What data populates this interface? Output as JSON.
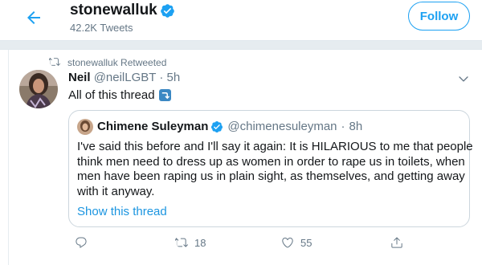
{
  "header": {
    "account_name": "stonewalluk",
    "tweet_count": "42.2K Tweets",
    "follow_label": "Follow"
  },
  "retweet_context": {
    "text": "stonewalluk Retweeted"
  },
  "tweet": {
    "author_name": "Neil",
    "author_handle": "@neilLGBT",
    "separator": "·",
    "time": "5h",
    "text": "All of this thread",
    "emoji": "right-arrow-curving-down"
  },
  "quoted_tweet": {
    "author_name": "Chimene Suleyman",
    "author_handle": "@chimenesuleyman",
    "separator": "·",
    "time": "8h",
    "lines": [
      "I've said this before and I'll say it again: It is HILARIOUS to me that people",
      "think men need to dress up as women in order to rape us in toilets, when",
      "men have been raping us in plain sight, as themselves, and getting away",
      "with it anyway."
    ],
    "show_thread": "Show this thread"
  },
  "actions": {
    "retweet_count": "18",
    "like_count": "55"
  },
  "colors": {
    "accent": "#1da1f2",
    "link": "#1b95e0",
    "muted": "#657786",
    "border": "#ccd6dd"
  }
}
